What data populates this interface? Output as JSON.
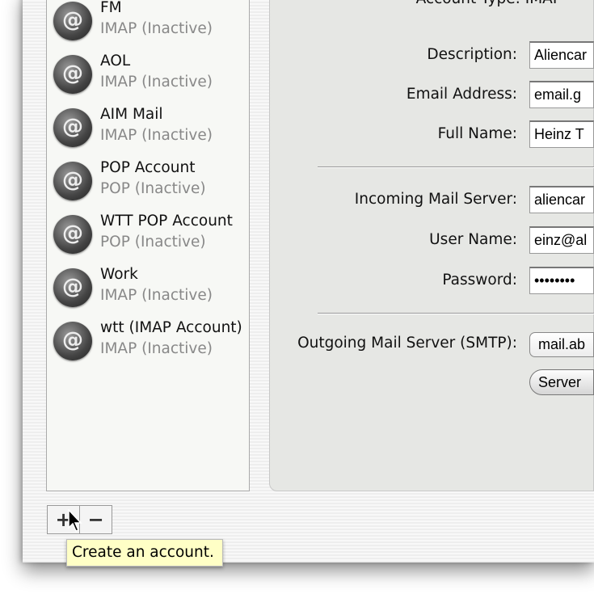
{
  "accounts": [
    {
      "name": "FM",
      "status": "IMAP (Inactive)"
    },
    {
      "name": "AOL",
      "status": "IMAP (Inactive)"
    },
    {
      "name": "AIM Mail",
      "status": "IMAP (Inactive)"
    },
    {
      "name": "POP Account",
      "status": "POP (Inactive)"
    },
    {
      "name": "WTT POP Account",
      "status": "POP (Inactive)"
    },
    {
      "name": "Work",
      "status": "IMAP (Inactive)"
    },
    {
      "name": "wtt (IMAP Account)",
      "status": "IMAP (Inactive)"
    }
  ],
  "account_icon": "@",
  "form": {
    "account_type_label": "Account Type:",
    "account_type_value": "IMAP",
    "description_label": "Description:",
    "description_value": "Aliencar",
    "email_label": "Email Address:",
    "email_value": "email.g",
    "fullname_label": "Full Name:",
    "fullname_value": "Heinz T",
    "incoming_label": "Incoming Mail Server:",
    "incoming_value": "aliencar",
    "username_label": "User Name:",
    "username_value": "einz@al",
    "password_label": "Password:",
    "password_value": "••••••••",
    "smtp_label": "Outgoing Mail Server (SMTP):",
    "smtp_value": "mail.ab",
    "server_button": "Server"
  },
  "add_button": "+",
  "remove_button": "−",
  "tooltip": "Create an account."
}
